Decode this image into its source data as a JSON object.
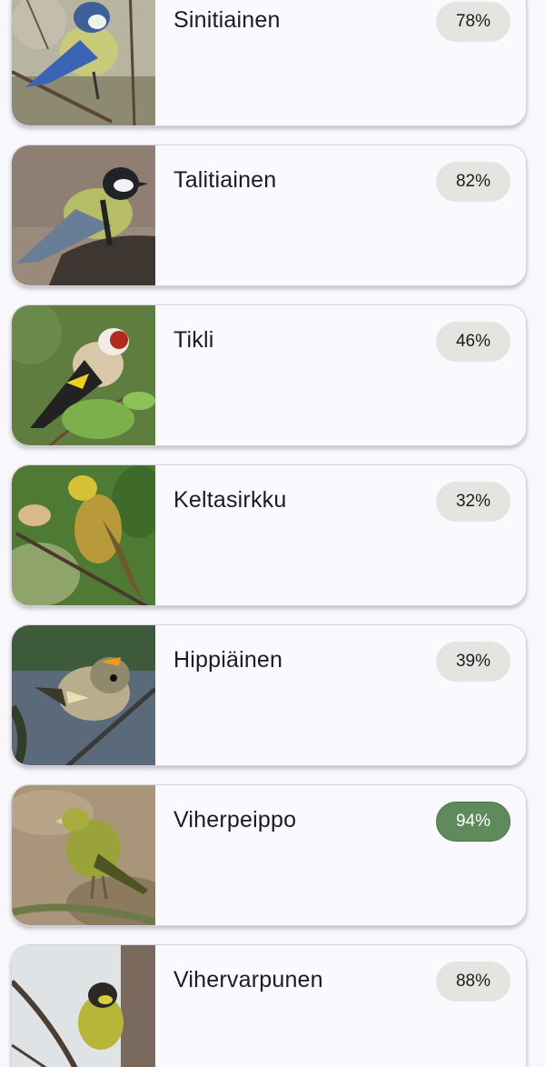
{
  "birds": [
    {
      "name": "Sinitiainen",
      "score": "78%",
      "highlighted": false,
      "image": "blue-tit-photo"
    },
    {
      "name": "Talitiainen",
      "score": "82%",
      "highlighted": false,
      "image": "great-tit-photo"
    },
    {
      "name": "Tikli",
      "score": "46%",
      "highlighted": false,
      "image": "goldfinch-photo"
    },
    {
      "name": "Keltasirkku",
      "score": "32%",
      "highlighted": false,
      "image": "yellowhammer-photo"
    },
    {
      "name": "Hippiäinen",
      "score": "39%",
      "highlighted": false,
      "image": "goldcrest-photo"
    },
    {
      "name": "Viherpeippo",
      "score": "94%",
      "highlighted": true,
      "image": "greenfinch-photo"
    },
    {
      "name": "Vihervarpunen",
      "score": "88%",
      "highlighted": false,
      "image": "siskin-photo"
    }
  ],
  "colors": {
    "background": "#f8f7fc",
    "card": "#faf9fe",
    "badge": "#e6e4e1",
    "badge_highlight": "#5f8a5c"
  }
}
